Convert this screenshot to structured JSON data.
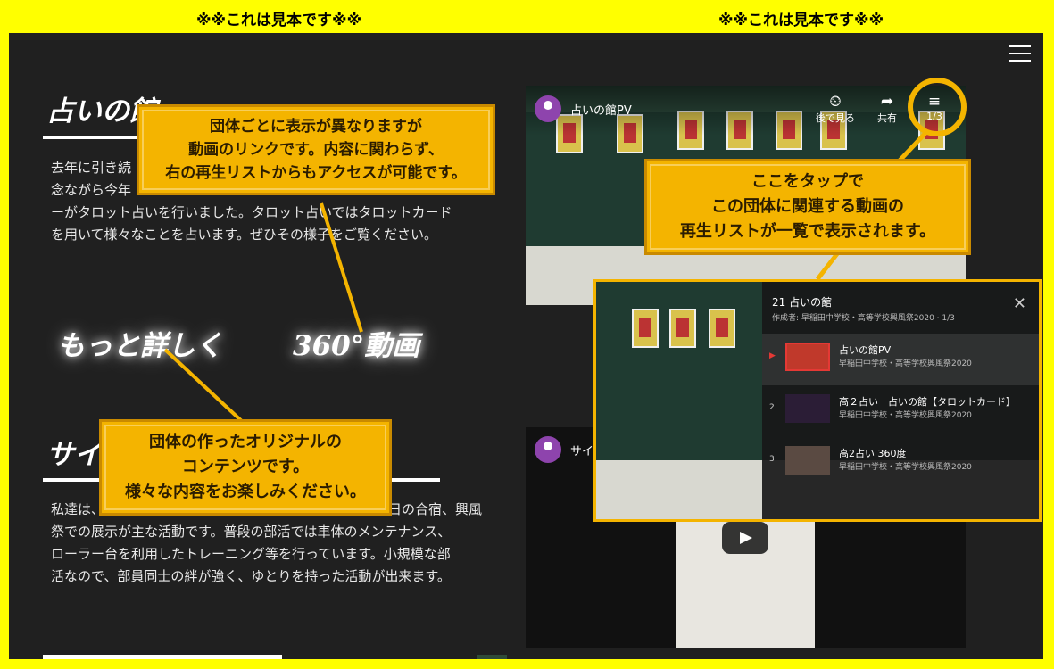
{
  "banner": {
    "left_text": "※※これは見本です※※",
    "right_text": "※※これは見本です※※"
  },
  "section1": {
    "title": "占いの館",
    "paragraph_lines": [
      "去年に引き続",
      "念ながら今年",
      "ーがタロット占いを行いました。タロット占いではタロットカード",
      "を用いて様々なことを占います。ぜひその様子をご覧ください。"
    ],
    "link_more": "もっと詳しく",
    "link_360": "360°動画"
  },
  "section2": {
    "title": "サイ",
    "paragraph_lines": [
      "私達は、",
      "祭での展示が主な活動です。普段の部活では車体のメンテナンス、",
      "ローラー台を利用したトレーニング等を行っています。小規模な部",
      "活なので、部員同士の絆が強く、ゆとりを持った活動が出来ます。"
    ],
    "line1_right": "日の合宿、興風"
  },
  "video1": {
    "title": "占いの館PV",
    "watch_later_label": "後で見る",
    "share_label": "共有",
    "playlist_counter": "1/3"
  },
  "video2": {
    "title": "サイ"
  },
  "callouts": {
    "video_link": [
      "団体ごとに表示が異なりますが",
      "動画のリンクです。内容に関わらず、",
      "右の再生リストからもアクセスが可能です。"
    ],
    "playlist_tap": [
      "ここをタップで",
      "この団体に関連する動画の",
      "再生リストが一覧で表示されます。"
    ],
    "original_content": [
      "団体の作ったオリジナルの",
      "コンテンツです。",
      "様々な内容をお楽しみください。"
    ]
  },
  "playlist": {
    "title": "21 占いの館",
    "subtitle": "作成者: 早稲田中学校・高等学校興風祭2020 · 1/3",
    "items": [
      {
        "index": "▶",
        "title": "占いの館PV",
        "channel": "早稲田中学校・高等学校興風祭2020"
      },
      {
        "index": "2",
        "title": "高２占い　占いの館【タロットカード】",
        "channel": "早稲田中学校・高等学校興風祭2020"
      },
      {
        "index": "3",
        "title": "高2占い 360度",
        "channel": "早稲田中学校・高等学校興風祭2020"
      }
    ]
  },
  "icons": {
    "menu": "hamburger-icon",
    "watch_later": "clock-icon",
    "share": "share-icon",
    "playlist": "playlist-icon",
    "close": "close-icon",
    "play": "play-icon"
  },
  "colors": {
    "banner": "#ffff00",
    "page_bg": "#202020",
    "callout": "#f4b400",
    "highlight_ring": "#f4b400",
    "accent_red": "#e53935"
  }
}
